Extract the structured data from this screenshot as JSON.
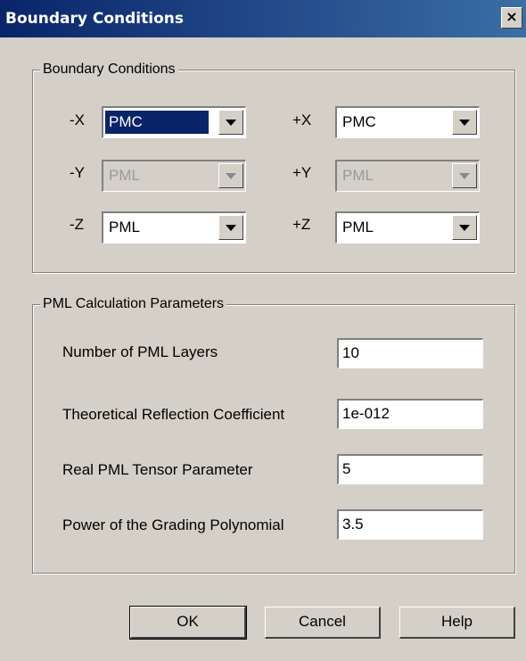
{
  "window": {
    "title": "Boundary Conditions",
    "close_glyph": "×"
  },
  "boundary_group": {
    "title": "Boundary Conditions",
    "rows": [
      {
        "minus_label": "-X",
        "minus_value": "PMC",
        "plus_label": "+X",
        "plus_value": "PMC"
      },
      {
        "minus_label": "-Y",
        "minus_value": "PML",
        "plus_label": "+Y",
        "plus_value": "PML"
      },
      {
        "minus_label": "-Z",
        "minus_value": "PML",
        "plus_label": "+Z",
        "plus_value": "PML"
      }
    ]
  },
  "pml_group": {
    "title": "PML Calculation Parameters",
    "params": [
      {
        "label": "Number of PML Layers",
        "value": "10"
      },
      {
        "label": "Theoretical Reflection Coefficient",
        "value": "1e-012"
      },
      {
        "label": "Real PML Tensor Parameter",
        "value": "5"
      },
      {
        "label": "Power of the Grading Polynomial",
        "value": "3.5"
      }
    ]
  },
  "buttons": {
    "ok": "OK",
    "cancel": "Cancel",
    "help": "Help"
  }
}
